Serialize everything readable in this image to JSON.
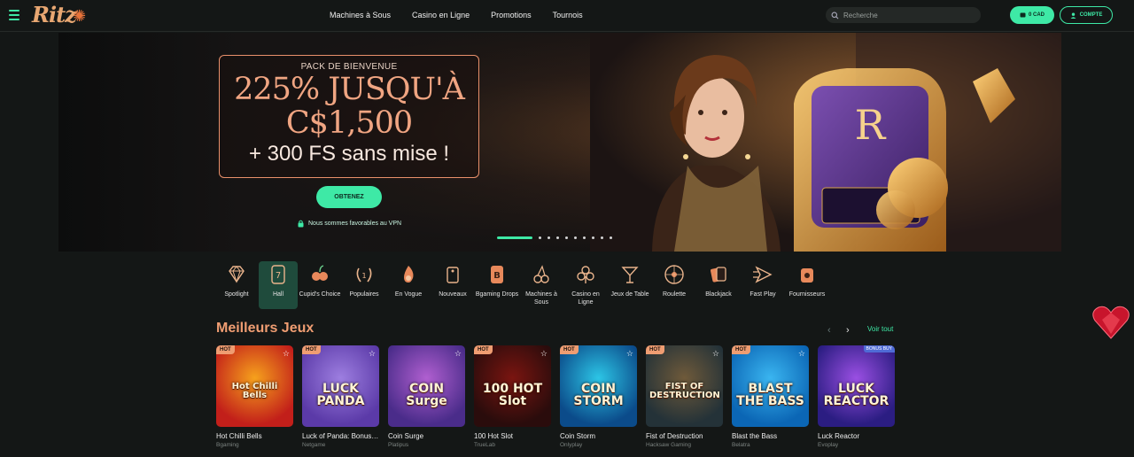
{
  "header": {
    "logo": "Ritz",
    "nav": [
      "Machines à Sous",
      "Casino en Ligne",
      "Promotions",
      "Tournois"
    ],
    "search_placeholder": "Recherche",
    "balance": "0 CAD",
    "account": "COMPTE"
  },
  "hero": {
    "kicker": "PACK DE BIENVENUE",
    "line1": "225% JUSQU'À",
    "line2": "C$1,500",
    "line3": "+ 300 FS sans mise !",
    "cta": "OBTENEZ",
    "vpn": "Nous sommes favorables au VPN",
    "slides": 10,
    "active_slide": 1
  },
  "categories": [
    {
      "label": "Spotlight",
      "icon": "diamond-icon"
    },
    {
      "label": "Hall",
      "icon": "slot-seven-icon",
      "active": true
    },
    {
      "label": "Cupid's Choice",
      "icon": "cherry-heart-icon"
    },
    {
      "label": "Populaires",
      "icon": "laurel-icon"
    },
    {
      "label": "En Vogue",
      "icon": "flame-icon"
    },
    {
      "label": "Nouveaux",
      "icon": "tag-icon"
    },
    {
      "label": "Bgaming Drops",
      "icon": "bgaming-icon"
    },
    {
      "label": "Machines à Sous",
      "icon": "cherries-icon"
    },
    {
      "label": "Casino en Ligne",
      "icon": "club-icon"
    },
    {
      "label": "Jeux de Table",
      "icon": "cocktail-icon"
    },
    {
      "label": "Roulette",
      "icon": "roulette-icon"
    },
    {
      "label": "Blackjack",
      "icon": "cards-icon"
    },
    {
      "label": "Fast Play",
      "icon": "fast-icon"
    },
    {
      "label": "Fournisseurs",
      "icon": "provider-icon"
    }
  ],
  "top_games": {
    "title": "Meilleurs Jeux",
    "see_all": "Voir tout",
    "games": [
      {
        "name": "Hot Chilli Bells",
        "provider": "Bgaming",
        "hot": "HOT",
        "art": "Hot Chilli Bells",
        "colors": [
          "#c21f1a",
          "#f6a11c"
        ]
      },
      {
        "name": "Luck of Panda: Bonus Combo",
        "provider": "Netgame",
        "hot": "HOT",
        "art": "LUCK PANDA",
        "colors": [
          "#5b3aa8",
          "#9d7ee0"
        ]
      },
      {
        "name": "Coin Surge",
        "provider": "Platipus",
        "hot": "",
        "art": "COIN Surge",
        "colors": [
          "#4a2c8a",
          "#b05fd0"
        ]
      },
      {
        "name": "100 Hot Slot",
        "provider": "TrueLab",
        "hot": "HOT",
        "art": "100 HOT Slot",
        "colors": [
          "#2a0c0c",
          "#7a1510"
        ]
      },
      {
        "name": "Coin Storm",
        "provider": "Onlyplay",
        "hot": "HOT",
        "art": "COIN STORM",
        "colors": [
          "#0b4b8a",
          "#2cc5e6"
        ]
      },
      {
        "name": "Fist of Destruction",
        "provider": "Hacksaw Gaming",
        "hot": "HOT",
        "art": "FIST OF DESTRUCTION",
        "colors": [
          "#243238",
          "#6f5a3a"
        ]
      },
      {
        "name": "Blast the Bass",
        "provider": "Belatra",
        "hot": "HOT",
        "art": "BLAST THE BASS",
        "colors": [
          "#0b66b5",
          "#3ab5f0"
        ]
      },
      {
        "name": "Luck Reactor",
        "provider": "Evoplay",
        "hot": "",
        "bonus": "BONUS BUY",
        "art": "LUCK REACTOR",
        "colors": [
          "#2b1d82",
          "#9a4fe3"
        ]
      }
    ]
  }
}
